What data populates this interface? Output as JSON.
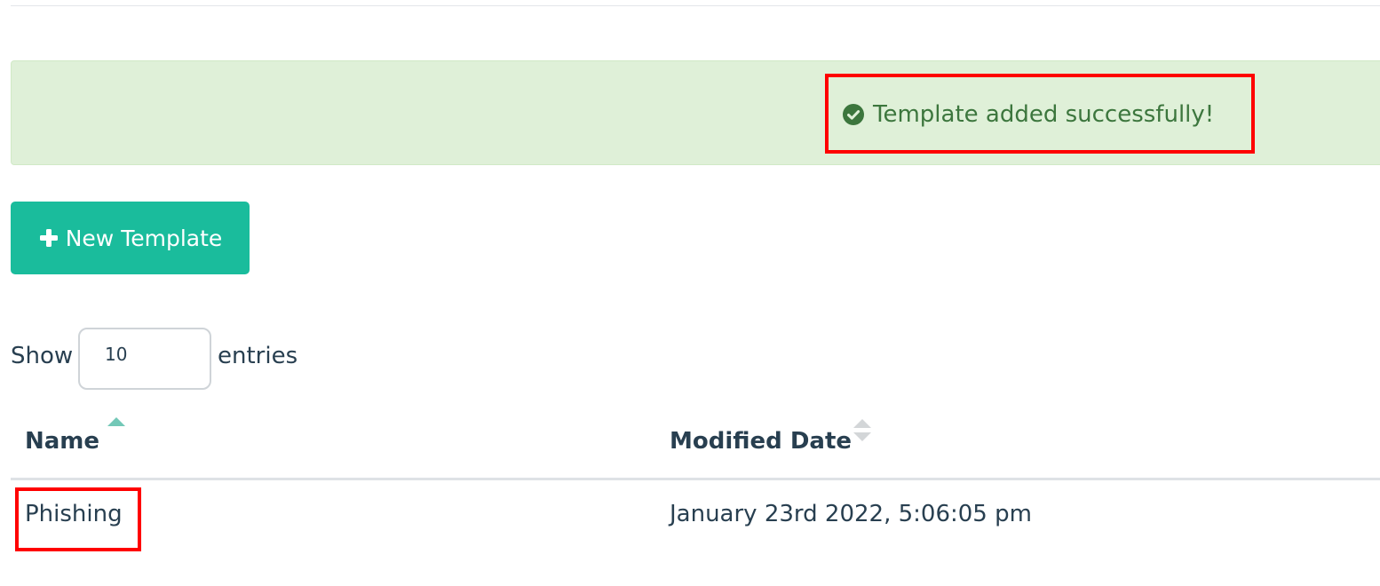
{
  "alert": {
    "message": "Template added successfully!",
    "icon": "check-circle-icon",
    "text_color": "#3c763d",
    "background": "#dff0d8"
  },
  "toolbar": {
    "new_template_label": "New Template",
    "new_template_icon": "plus-icon",
    "button_color": "#1abc9c"
  },
  "table_length": {
    "show_label": "Show",
    "value": "10",
    "entries_label": "entries"
  },
  "table": {
    "columns": [
      {
        "label": "Name",
        "sort": "ascending"
      },
      {
        "label": "Modified Date",
        "sort": "none"
      }
    ],
    "rows": [
      {
        "name": "Phishing",
        "modified_date": "January 23rd 2022, 5:06:05 pm"
      }
    ]
  },
  "highlight_color": "#ff0000"
}
